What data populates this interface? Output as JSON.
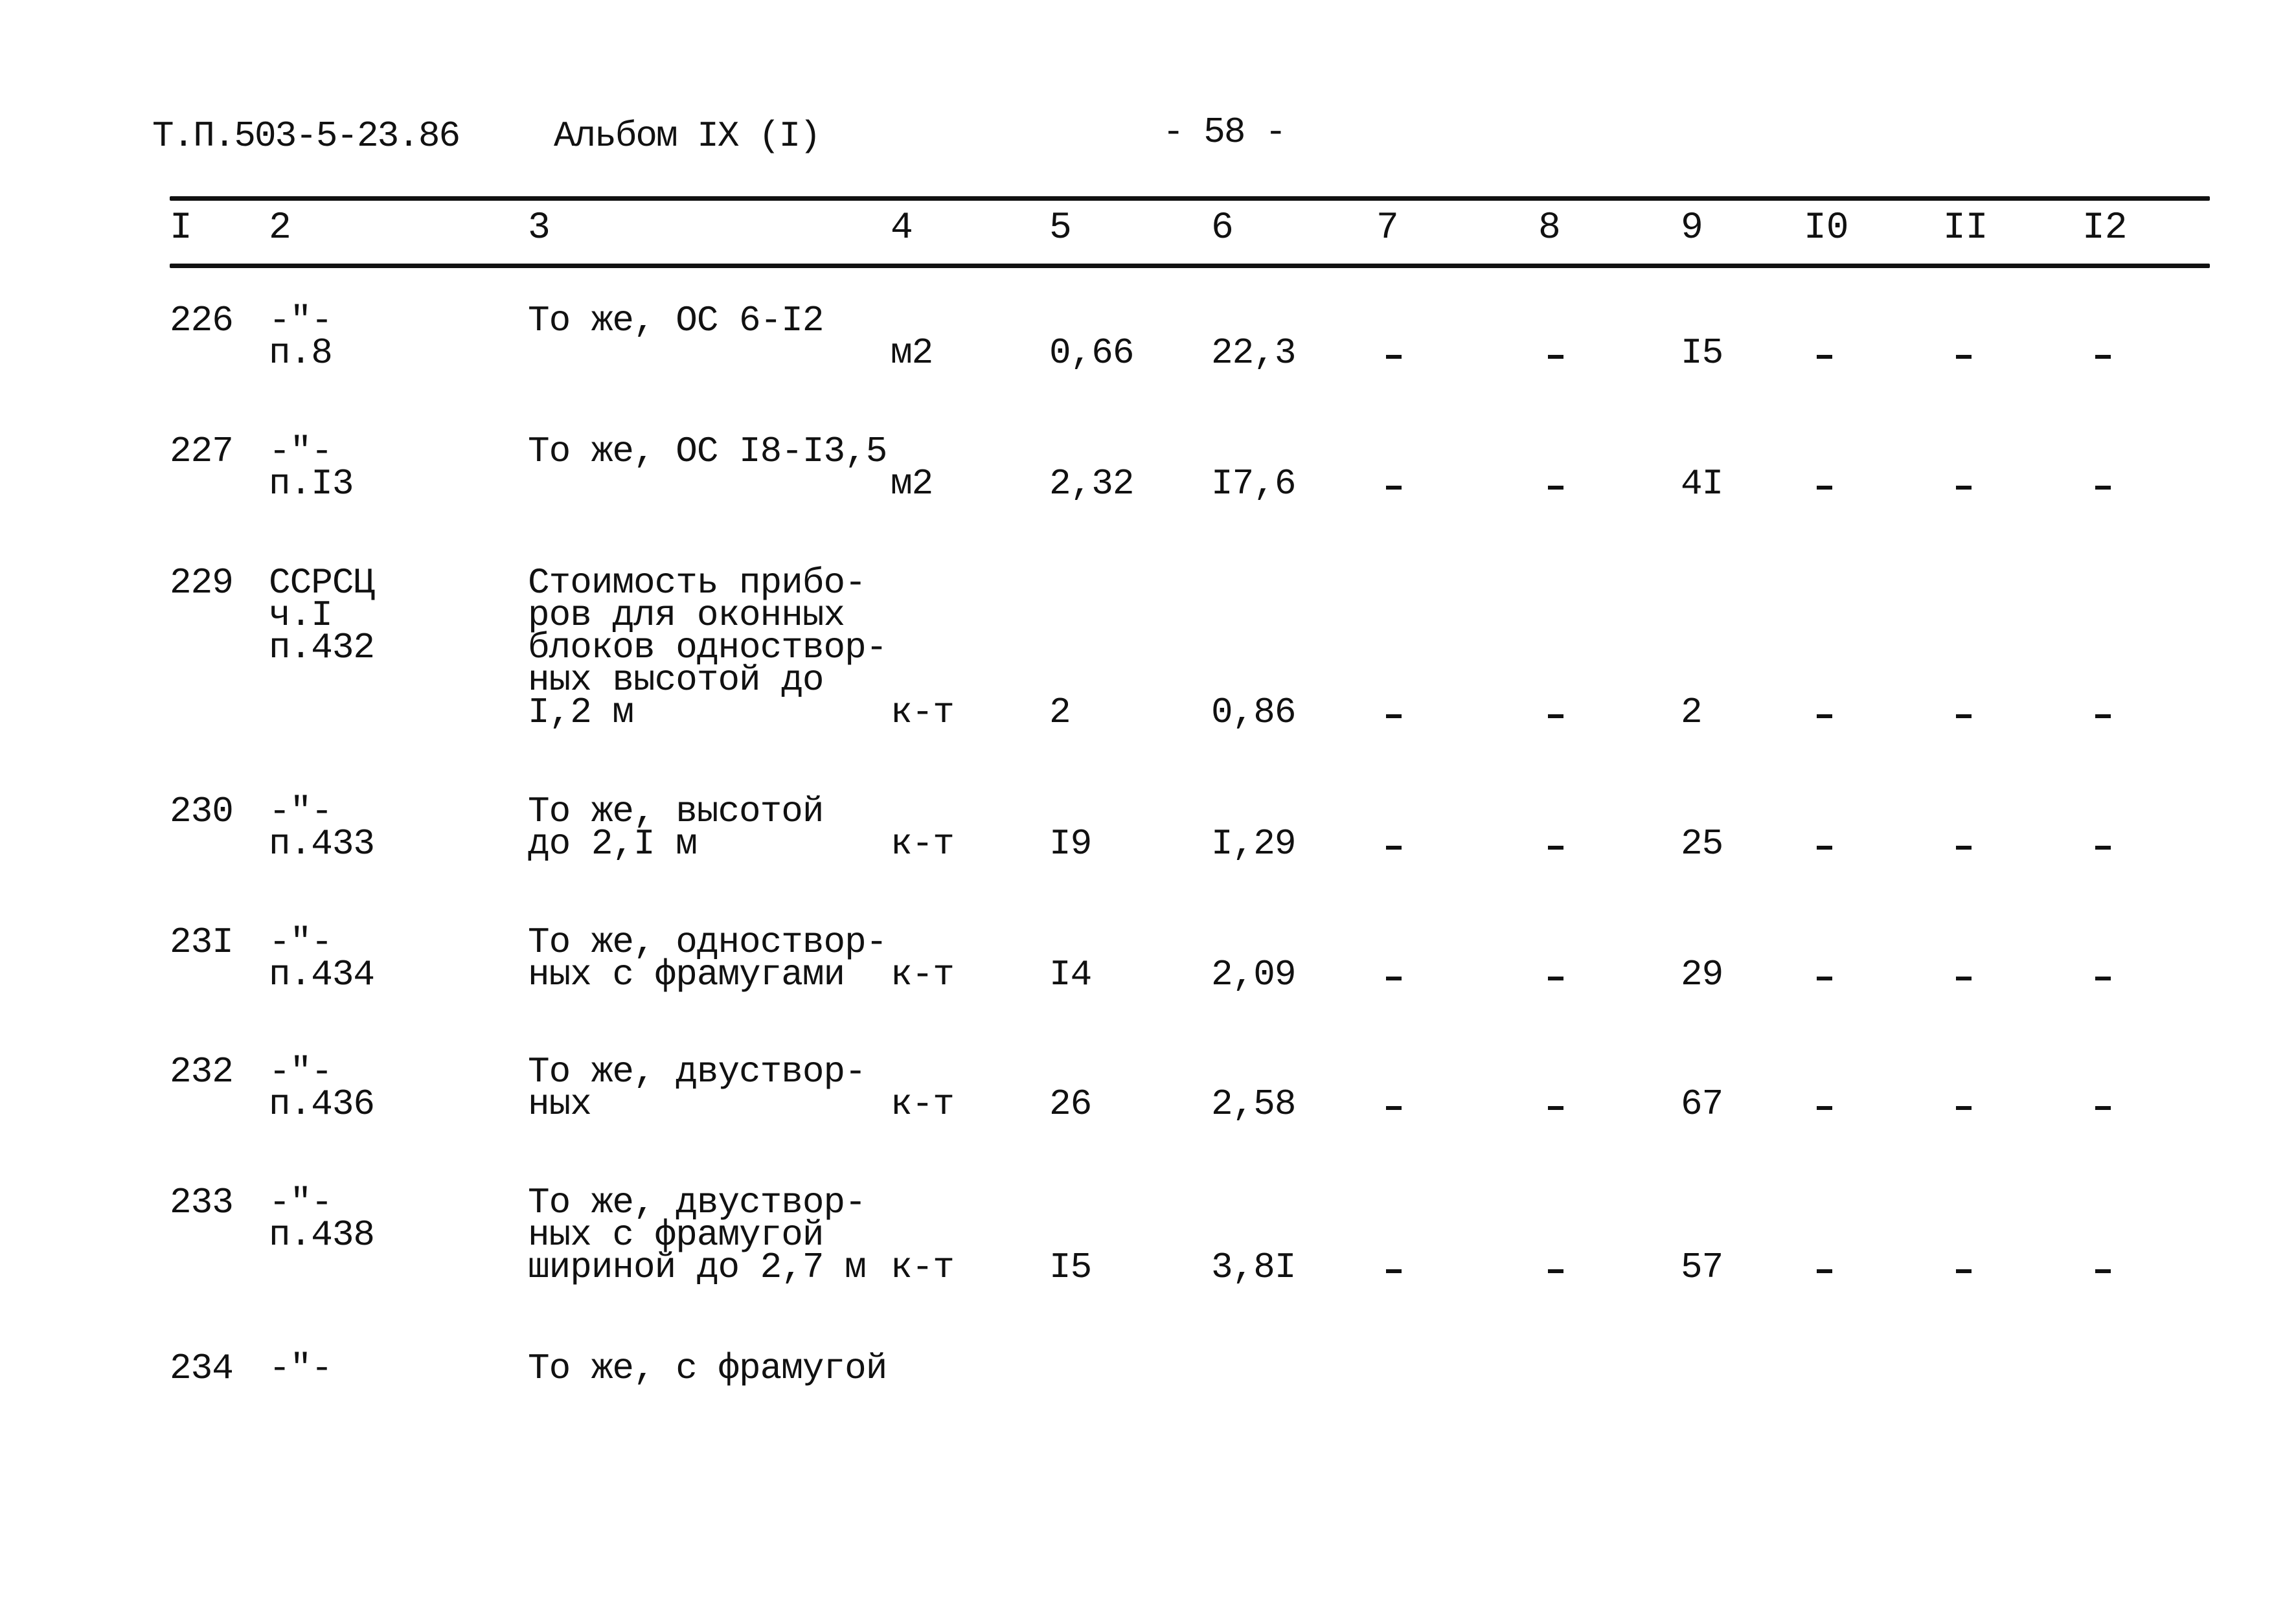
{
  "header": {
    "doc_code": "Т.П.503-5-23.86",
    "album": "Альбом IX (I)",
    "page_number": "- 58 -"
  },
  "columns": [
    "I",
    "2",
    "3",
    "4",
    "5",
    "6",
    "7",
    "8",
    "9",
    "I0",
    "II",
    "I2"
  ],
  "rows": [
    {
      "num": "226",
      "source": [
        "-\"-",
        "п.8"
      ],
      "desc": [
        "То же, ОС 6-I2"
      ],
      "unit": "м2",
      "c5": "0,66",
      "c6": "22,3",
      "c7": "-",
      "c8": "-",
      "c9": "I5",
      "c10": "-",
      "c11": "-",
      "c12": "-"
    },
    {
      "num": "227",
      "source": [
        "-\"-",
        "п.I3"
      ],
      "desc": [
        "То же, ОС I8-I3,5"
      ],
      "unit": "м2",
      "c5": "2,32",
      "c6": "I7,6",
      "c7": "-",
      "c8": "-",
      "c9": "4I",
      "c10": "-",
      "c11": "-",
      "c12": "-"
    },
    {
      "num": "229",
      "source": [
        "ССРСЦ",
        "ч.I",
        "п.432"
      ],
      "desc": [
        "Стоимость прибо-",
        "ров для оконных",
        "блоков одноствор-",
        "ных высотой до",
        "I,2 м"
      ],
      "unit": "к-т",
      "c5": "2",
      "c6": "0,86",
      "c7": "-",
      "c8": "-",
      "c9": "2",
      "c10": "-",
      "c11": "-",
      "c12": "-"
    },
    {
      "num": "230",
      "source": [
        "-\"-",
        "п.433"
      ],
      "desc": [
        "То же, высотой",
        "до 2,I м"
      ],
      "unit": "к-т",
      "c5": "I9",
      "c6": "I,29",
      "c7": "-",
      "c8": "-",
      "c9": "25",
      "c10": "-",
      "c11": "-",
      "c12": "-"
    },
    {
      "num": "23I",
      "source": [
        "-\"-",
        "п.434"
      ],
      "desc": [
        "То же, одноствор-",
        "ных с фрамугами"
      ],
      "unit": "к-т",
      "c5": "I4",
      "c6": "2,09",
      "c7": "-",
      "c8": "-",
      "c9": "29",
      "c10": "-",
      "c11": "-",
      "c12": "-"
    },
    {
      "num": "232",
      "source": [
        "-\"-",
        "п.436"
      ],
      "desc": [
        "То же, двуствор-",
        "ных"
      ],
      "unit": "к-т",
      "c5": "26",
      "c6": "2,58",
      "c7": "-",
      "c8": "-",
      "c9": "67",
      "c10": "-",
      "c11": "-",
      "c12": "-"
    },
    {
      "num": "233",
      "source": [
        "-\"-",
        "п.438"
      ],
      "desc": [
        "То же, двуствор-",
        "ных с фрамугой",
        "шириной до 2,7 м"
      ],
      "unit": "к-т",
      "c5": "I5",
      "c6": "3,8I",
      "c7": "-",
      "c8": "-",
      "c9": "57",
      "c10": "-",
      "c11": "-",
      "c12": "-"
    },
    {
      "num": "234",
      "source": [
        "-\"-"
      ],
      "desc": [
        "То же, с фрамугой"
      ],
      "unit": "",
      "c5": "",
      "c6": "",
      "c7": "",
      "c8": "",
      "c9": "",
      "c10": "",
      "c11": "",
      "c12": ""
    }
  ]
}
